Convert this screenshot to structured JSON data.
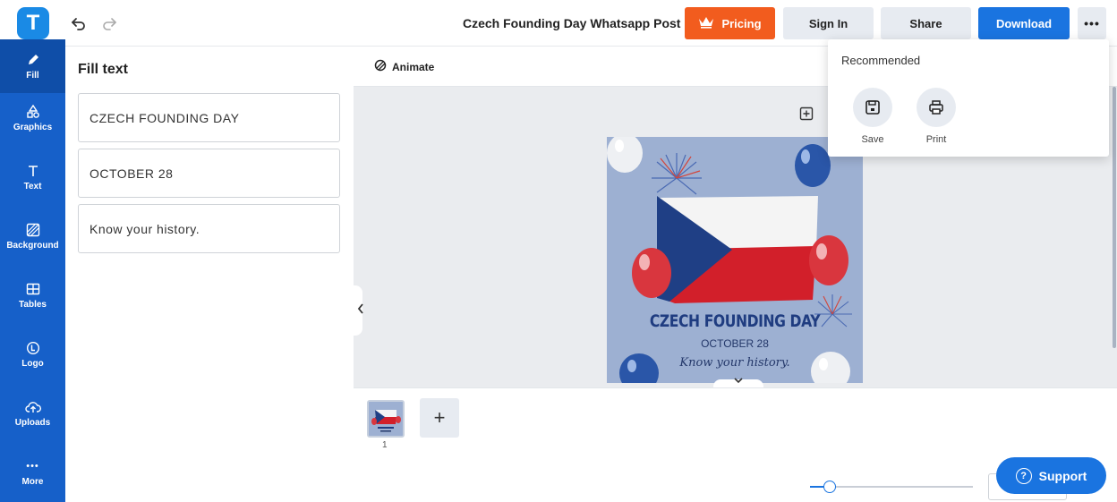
{
  "header": {
    "logo_letter": "T",
    "document_title": "Czech Founding Day Whatsapp Post",
    "pricing_label": "Pricing",
    "signin_label": "Sign In",
    "share_label": "Share",
    "download_label": "Download",
    "more_label": "•••"
  },
  "sidebar": {
    "items": [
      {
        "label": "Fill",
        "icon": "pencil-icon"
      },
      {
        "label": "Graphics",
        "icon": "shapes-icon"
      },
      {
        "label": "Text",
        "icon": "text-icon"
      },
      {
        "label": "Background",
        "icon": "background-icon"
      },
      {
        "label": "Tables",
        "icon": "table-icon"
      },
      {
        "label": "Logo",
        "icon": "logo-icon"
      },
      {
        "label": "Uploads",
        "icon": "cloud-upload-icon"
      },
      {
        "label": "More",
        "icon": "more-icon"
      }
    ],
    "more_dots": "•••"
  },
  "fill_panel": {
    "title": "Fill text",
    "fields": [
      "CZECH FOUNDING DAY",
      "OCTOBER 28",
      "Know your history."
    ]
  },
  "workspace": {
    "animate_label": "Animate"
  },
  "design": {
    "title": "CZECH FOUNDING DAY",
    "date": "OCTOBER 28",
    "tagline": "Know your history.",
    "colors": {
      "background": "#9db0d2",
      "flag_blue": "#1f3f85",
      "flag_red": "#d21f2a",
      "flag_white": "#f4f4f4",
      "balloon_red": "#d9363e",
      "balloon_blue": "#2a56a8"
    }
  },
  "pages": {
    "page_number": "1",
    "add_label": "+",
    "zoom_level_fraction": 0.12
  },
  "dropdown": {
    "heading": "Recommended",
    "items": [
      {
        "label": "Save",
        "icon": "save-icon"
      },
      {
        "label": "Print",
        "icon": "print-icon"
      }
    ]
  },
  "support": {
    "label": "Support",
    "icon_text": "?"
  },
  "colors": {
    "brand_blue": "#1a74e0",
    "rail_blue": "#1660c9",
    "pricing_orange": "#f25c1e"
  }
}
